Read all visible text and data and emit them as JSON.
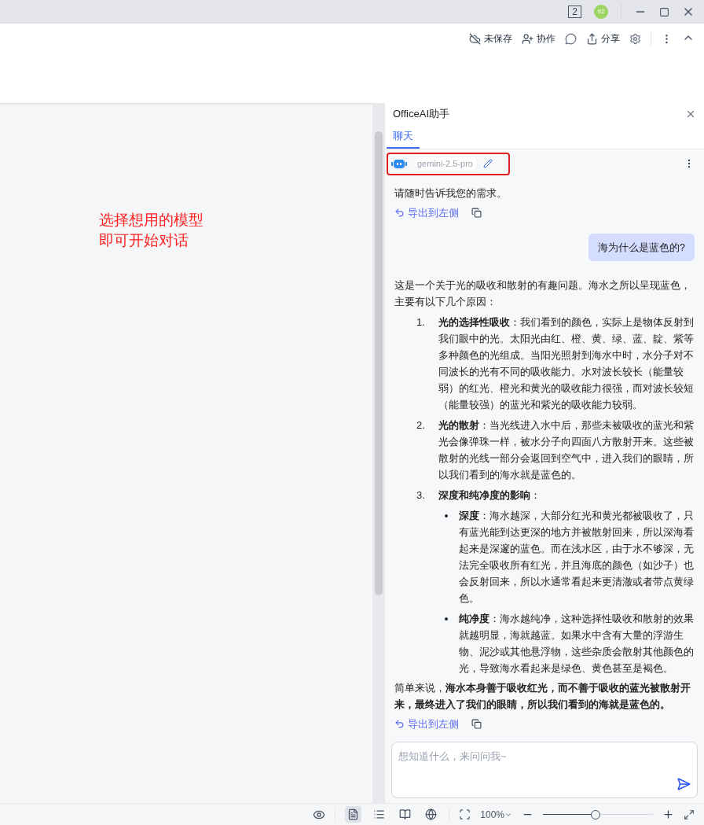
{
  "title_bar": {
    "window_count": "2",
    "avatar": "92"
  },
  "toolbar": {
    "items": [
      {
        "kind": "cloud",
        "label": "未保存"
      },
      {
        "kind": "user",
        "label": "协作"
      },
      {
        "kind": "comment"
      },
      {
        "kind": "share",
        "label": "分享"
      },
      {
        "kind": "gear"
      }
    ]
  },
  "document": {
    "annotation": [
      "选择想用的模型",
      "即可开始对话"
    ]
  },
  "panel": {
    "title": "OfficeAI助手",
    "tabs": [
      {
        "label": "聊天",
        "selected": true
      }
    ],
    "model": {
      "name": "gemini-2.5-pro"
    },
    "messages": [
      {
        "kind": "reply",
        "paragraphs": [
          "请随时告诉我您的需求。"
        ],
        "export": "导出到左侧"
      },
      {
        "kind": "question",
        "text": "海为什么是蓝色的?"
      },
      {
        "kind": "reply",
        "paragraphs": [
          "这是一个关于光的吸收和散射的有趣问题。海水之所以呈现蓝色，主要有以下几个原因："
        ],
        "list": [
          {
            "num": "1.",
            "text": "**光的选择性吸收**：我们看到的颜色，实际上是物体反射到我们眼中的光。太阳光由红、橙、黄、绿、蓝、靛、紫等多种颜色的光组成。当阳光照射到海水中时，水分子对不同波长的光有不同的吸收能力。水对波长较长（能量较弱）的红光、橙光和黄光的吸收能力很强，而对波长较短（能量较强）的蓝光和紫光的吸收能力较弱。"
          },
          {
            "num": "2.",
            "text": "**光的散射**：当光线进入水中后，那些未被吸收的蓝光和紫光会像弹珠一样，被水分子向四面八方散射开来。这些被散射的光线一部分会返回到空气中，进入我们的眼睛，所以我们看到的海水就是蓝色的。"
          },
          {
            "num": "3.",
            "text": "**深度和纯净度的影响**：",
            "bullets": [
              "**深度**：海水越深，大部分红光和黄光都被吸收了，只有蓝光能到达更深的地方并被散射回来，所以深海看起来是深邃的蓝色。而在浅水区，由于水不够深，无法完全吸收所有红光，并且海底的颜色（如沙子）也会反射回来，所以水通常看起来更清澈或者带点黄绿色。",
              "**纯净度**：海水越纯净，这种选择性吸收和散射的效果就越明显，海就越蓝。如果水中含有大量的浮游生物、泥沙或其他悬浮物，这些杂质会散射其他颜色的光，导致海水看起来是绿色、黄色甚至是褐色。"
            ]
          }
        ],
        "summary": "简单来说，**海水本身善于吸收红光，而不善于吸收的蓝光被散射开来，最终进入了我们的眼睛，所以我们看到的海就是蓝色的。**",
        "export": "导出到左侧"
      }
    ],
    "input": {
      "placeholder": "想知道什么，来问问我~"
    }
  },
  "status_bar": {
    "views": [
      {
        "kind": "page",
        "selected": true
      },
      {
        "kind": "outline",
        "selected": false
      },
      {
        "kind": "book",
        "selected": false
      },
      {
        "kind": "web",
        "selected": false
      }
    ],
    "zoom": "100%",
    "zoom_slider": {
      "level": 0.48
    }
  }
}
